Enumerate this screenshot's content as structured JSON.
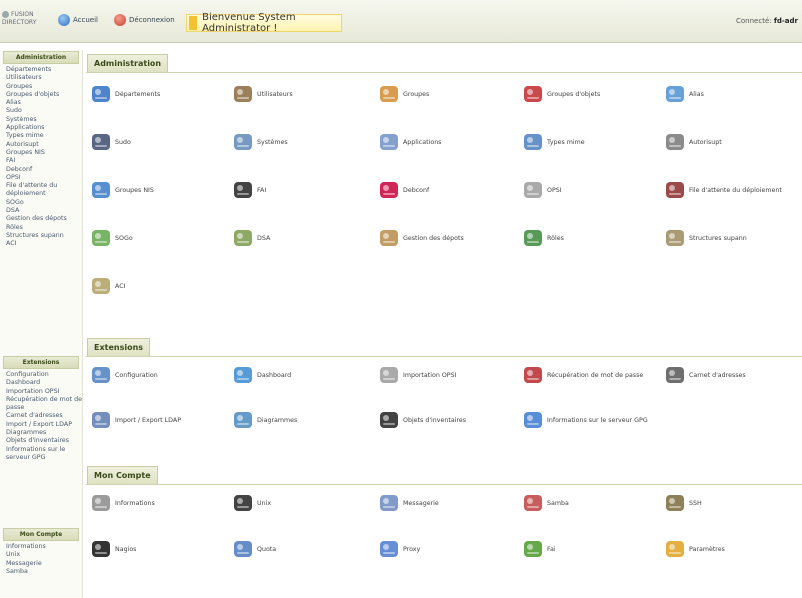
{
  "header": {
    "logo": "FUSION DIRECTORY",
    "home": "Accueil",
    "logout": "Déconnexion",
    "welcome": "Bienvenue System Administrator !",
    "connected_label": "Connecté:",
    "connected_user": "fd-adr"
  },
  "sidebar": {
    "sections": [
      {
        "title": "Administration",
        "items": [
          "Départements",
          "Utilisateurs",
          "Groupes",
          "Groupes d'objets",
          "Alias",
          "Sudo",
          "Systèmes",
          "Applications",
          "Types mime",
          "Autorisupt",
          "Groupes NIS",
          "FAI",
          "Debconf",
          "OPSI",
          "File d'attente du déploiement",
          "SOGo",
          "DSA",
          "Gestion des dépots",
          "Rôles",
          "Structures supann",
          "ACI"
        ]
      },
      {
        "title": "Extensions",
        "items": [
          "Configuration",
          "Dashboard",
          "Importation OPSI",
          "Récupération de mot de passe",
          "Carnet d'adresses",
          "Import / Export LDAP",
          "Diagrammes",
          "Objets d'inventaires",
          "Informations sur le serveur GPG"
        ]
      },
      {
        "title": "Mon Compte",
        "items": [
          "Informations",
          "Unix",
          "Messagerie",
          "Samba"
        ]
      }
    ]
  },
  "main": {
    "administration": {
      "title": "Administration",
      "tiles": [
        {
          "label": "Départements",
          "icon": "departments-icon",
          "color": "#2f6fc2"
        },
        {
          "label": "Utilisateurs",
          "icon": "user-icon",
          "color": "#8a6a3c"
        },
        {
          "label": "Groupes",
          "icon": "groups-icon",
          "color": "#d28a2e"
        },
        {
          "label": "Groupes d'objets",
          "icon": "object-groups-icon",
          "color": "#c2282c"
        },
        {
          "label": "Alias",
          "icon": "alias-icon",
          "color": "#4d8fd1"
        },
        {
          "label": "Sudo",
          "icon": "sudo-shield-icon",
          "color": "#3a4c6e"
        },
        {
          "label": "Systèmes",
          "icon": "systems-icon",
          "color": "#5f88b8"
        },
        {
          "label": "Applications",
          "icon": "applications-icon",
          "color": "#6f8fc5"
        },
        {
          "label": "Types mime",
          "icon": "mime-types-icon",
          "color": "#4a7fc0"
        },
        {
          "label": "Autorisupt",
          "icon": "keyboard-icon",
          "color": "#777777"
        },
        {
          "label": "Groupes NIS",
          "icon": "nis-groups-icon",
          "color": "#3a7bc8"
        },
        {
          "label": "FAI",
          "icon": "fai-icon",
          "color": "#222222"
        },
        {
          "label": "Debconf",
          "icon": "debian-icon",
          "color": "#c8003a"
        },
        {
          "label": "OPSI",
          "icon": "opsi-cd-icon",
          "color": "#9a9a9a"
        },
        {
          "label": "File d'attente du déploiement",
          "icon": "deployment-queue-icon",
          "color": "#8a2a2a"
        },
        {
          "label": "SOGo",
          "icon": "sogo-icon",
          "color": "#5fa84a"
        },
        {
          "label": "DSA",
          "icon": "dsa-icon",
          "color": "#7a9a4a"
        },
        {
          "label": "Gestion des dépots",
          "icon": "repository-box-icon",
          "color": "#b88a4a"
        },
        {
          "label": "Rôles",
          "icon": "roles-icon",
          "color": "#3a8a3a"
        },
        {
          "label": "Structures supann",
          "icon": "supann-structures-icon",
          "color": "#9a8a5a"
        },
        {
          "label": "ACI",
          "icon": "aci-lock-icon",
          "color": "#b0a060"
        }
      ]
    },
    "extensions": {
      "title": "Extensions",
      "tiles": [
        {
          "label": "Configuration",
          "icon": "configuration-icon",
          "color": "#4a7fc0"
        },
        {
          "label": "Dashboard",
          "icon": "dashboard-icon",
          "color": "#3a8ad0"
        },
        {
          "label": "Importation OPSI",
          "icon": "opsi-import-icon",
          "color": "#9a9a9a"
        },
        {
          "label": "Récupération de mot de passe",
          "icon": "password-recovery-icon",
          "color": "#b8282a"
        },
        {
          "label": "Carnet d'adresses",
          "icon": "address-book-icon",
          "color": "#555555"
        },
        {
          "label": "Import / Export LDAP",
          "icon": "ldap-import-export-icon",
          "color": "#5a7ab0"
        },
        {
          "label": "Diagrammes",
          "icon": "diagrams-icon",
          "color": "#4a8ac0"
        },
        {
          "label": "Objets d'inventaires",
          "icon": "inventory-objects-icon",
          "color": "#222222"
        },
        {
          "label": "Informations sur le serveur GPG",
          "icon": "gpg-server-icon",
          "color": "#3a7ad0"
        }
      ]
    },
    "account": {
      "title": "Mon Compte",
      "tiles": [
        {
          "label": "Informations",
          "icon": "informations-icon",
          "color": "#8a8a8a"
        },
        {
          "label": "Unix",
          "icon": "unix-tux-icon",
          "color": "#222222"
        },
        {
          "label": "Messagerie",
          "icon": "mail-icon",
          "color": "#6a8ac0"
        },
        {
          "label": "Samba",
          "icon": "samba-icon",
          "color": "#c04040"
        },
        {
          "label": "SSH",
          "icon": "ssh-icon",
          "color": "#7a6a3a"
        },
        {
          "label": "Nagios",
          "icon": "nagios-icon",
          "color": "#111111"
        },
        {
          "label": "Quota",
          "icon": "quota-icon",
          "color": "#4a7ac0"
        },
        {
          "label": "Proxy",
          "icon": "proxy-icon",
          "color": "#4a7ad0"
        },
        {
          "label": "Fai",
          "icon": "fai-leaf-icon",
          "color": "#4a9a2a"
        },
        {
          "label": "Paramètres",
          "icon": "padlock-icon",
          "color": "#e0a020"
        }
      ]
    }
  }
}
